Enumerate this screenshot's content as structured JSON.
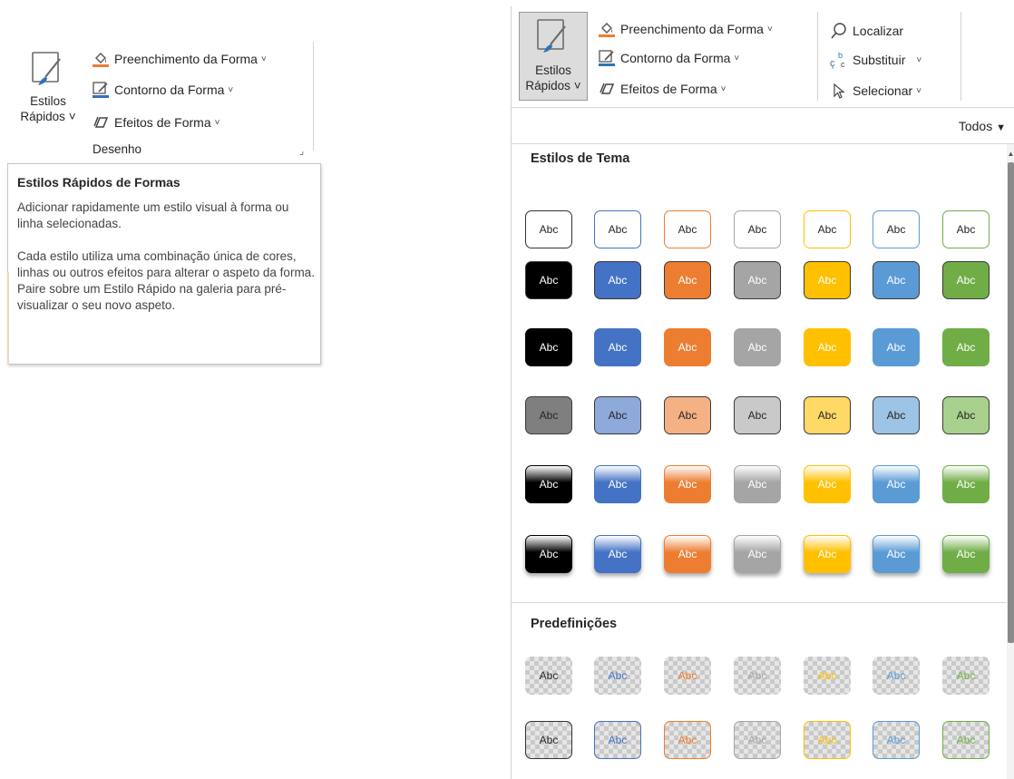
{
  "left_ribbon": {
    "quick_styles_label_line1": "Estilos",
    "quick_styles_label_line2": "Rápidos ˅",
    "shape_fill": "Preenchimento da Forma",
    "shape_outline": "Contorno da Forma",
    "shape_effects": "Efeitos de Forma",
    "group_label": "Desenho"
  },
  "tooltip": {
    "title": "Estilos Rápidos de Formas",
    "paragraph1": "Adicionar rapidamente um estilo visual à forma ou linha selecionadas.",
    "paragraph2": "Cada estilo utiliza uma combinação única de cores, linhas ou outros efeitos para alterar o aspeto da forma. Paire sobre um Estilo Rápido na galeria para pré-visualizar o seu novo aspeto."
  },
  "right_ribbon": {
    "quick_styles_label_line1": "Estilos",
    "quick_styles_label_line2": "Rápidos ˅",
    "shape_fill": "Preenchimento da Forma",
    "shape_outline": "Contorno da Forma",
    "shape_effects": "Efeitos de Forma",
    "find": "Localizar",
    "replace": "Substituir",
    "select": "Selecionar"
  },
  "gallery": {
    "filter": "Todos",
    "section_theme": "Estilos de Tema",
    "section_presets": "Predefinições",
    "swatch_text": "Abc",
    "palette": [
      "#000000",
      "#4472c4",
      "#ed7d31",
      "#a5a5a5",
      "#ffc000",
      "#5b9bd5",
      "#70ad47"
    ],
    "light_palette": [
      "#7f7f7f",
      "#8eaadb",
      "#f4b183",
      "#c9c9c9",
      "#ffd966",
      "#9dc3e6",
      "#a9d18e"
    ]
  },
  "icons": {
    "quick_styles": "paintbrush-icon",
    "fill": "paint-bucket-icon",
    "outline": "pen-outline-icon",
    "effects": "shape-effects-icon",
    "find": "magnifier-icon",
    "replace": "replace-icon",
    "select": "cursor-icon",
    "launcher": "dialog-launcher-icon",
    "filter_dropdown": "triangle-down-icon"
  }
}
